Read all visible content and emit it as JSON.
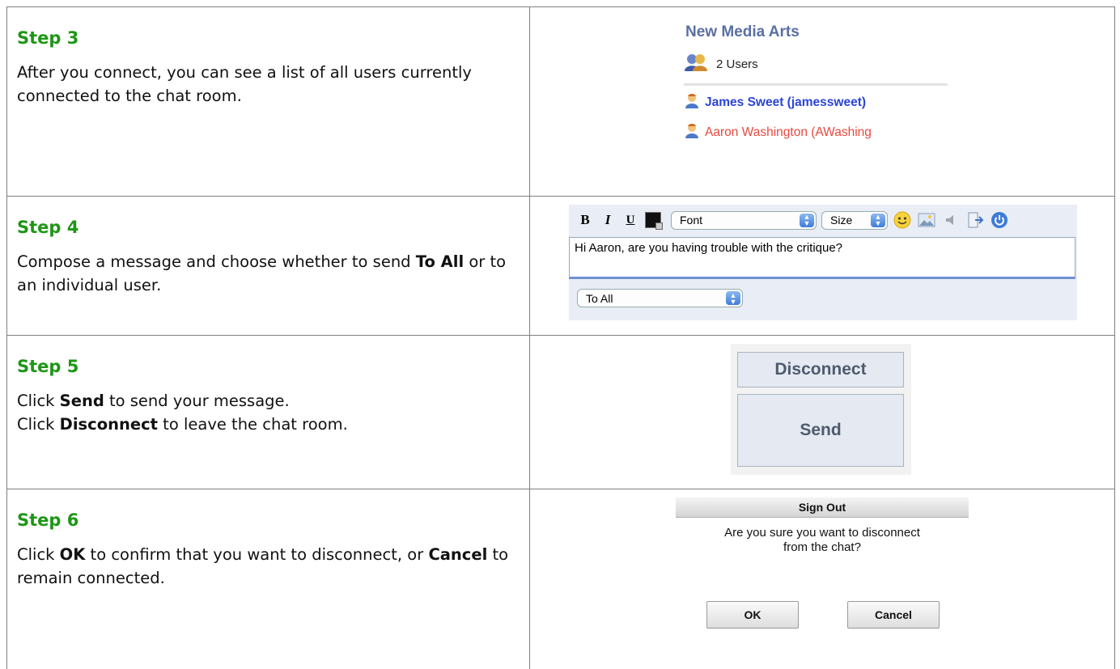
{
  "steps": [
    {
      "title": "Step 3",
      "lines": [
        [
          {
            "t": "After you connect, you can see a list of all users currently connected to the chat room.",
            "b": false
          }
        ]
      ]
    },
    {
      "title": "Step 4",
      "lines": [
        [
          {
            "t": "Compose a message and choose whether to send ",
            "b": false
          },
          {
            "t": "To All",
            "b": true
          },
          {
            "t": " or to an individual user.",
            "b": false
          }
        ]
      ]
    },
    {
      "title": "Step 5",
      "lines": [
        [
          {
            "t": "Click ",
            "b": false
          },
          {
            "t": "Send",
            "b": true
          },
          {
            "t": " to send your message.",
            "b": false
          }
        ],
        [
          {
            "t": "Click ",
            "b": false
          },
          {
            "t": "Disconnect",
            "b": true
          },
          {
            "t": " to leave the chat room.",
            "b": false
          }
        ]
      ]
    },
    {
      "title": "Step 6",
      "lines": [
        [
          {
            "t": "Click ",
            "b": false
          },
          {
            "t": "OK",
            "b": true
          },
          {
            "t": " to confirm that you want to disconnect, or ",
            "b": false
          },
          {
            "t": "Cancel",
            "b": true
          },
          {
            "t": " to remain connected.",
            "b": false
          }
        ]
      ]
    }
  ],
  "room": {
    "title": "New Media Arts",
    "users_count": "2 Users",
    "users": [
      {
        "name": "James Sweet (jamessweet)",
        "color": "#2b45d6"
      },
      {
        "name": "Aaron Washington (AWashing",
        "color": "#e8473f"
      }
    ]
  },
  "composer": {
    "bold": "B",
    "italic": "I",
    "underline": "U",
    "font_select": "Font",
    "size_select": "Size",
    "message": "Hi Aaron, are you having trouble with the critique?",
    "recipient_select": "To All",
    "icons": [
      "smiley-icon",
      "image-icon",
      "speaker-icon",
      "exit-icon",
      "power-icon"
    ]
  },
  "buttons": {
    "disconnect": "Disconnect",
    "send": "Send"
  },
  "dialog": {
    "title": "Sign Out",
    "message_line1": "Are you sure you want to disconnect",
    "message_line2": "from the chat?",
    "ok": "OK",
    "cancel": "Cancel"
  },
  "colors": {
    "step_title": "#1e9616",
    "room_title": "#5a6fa3",
    "button_text": "#4f5b6d"
  }
}
